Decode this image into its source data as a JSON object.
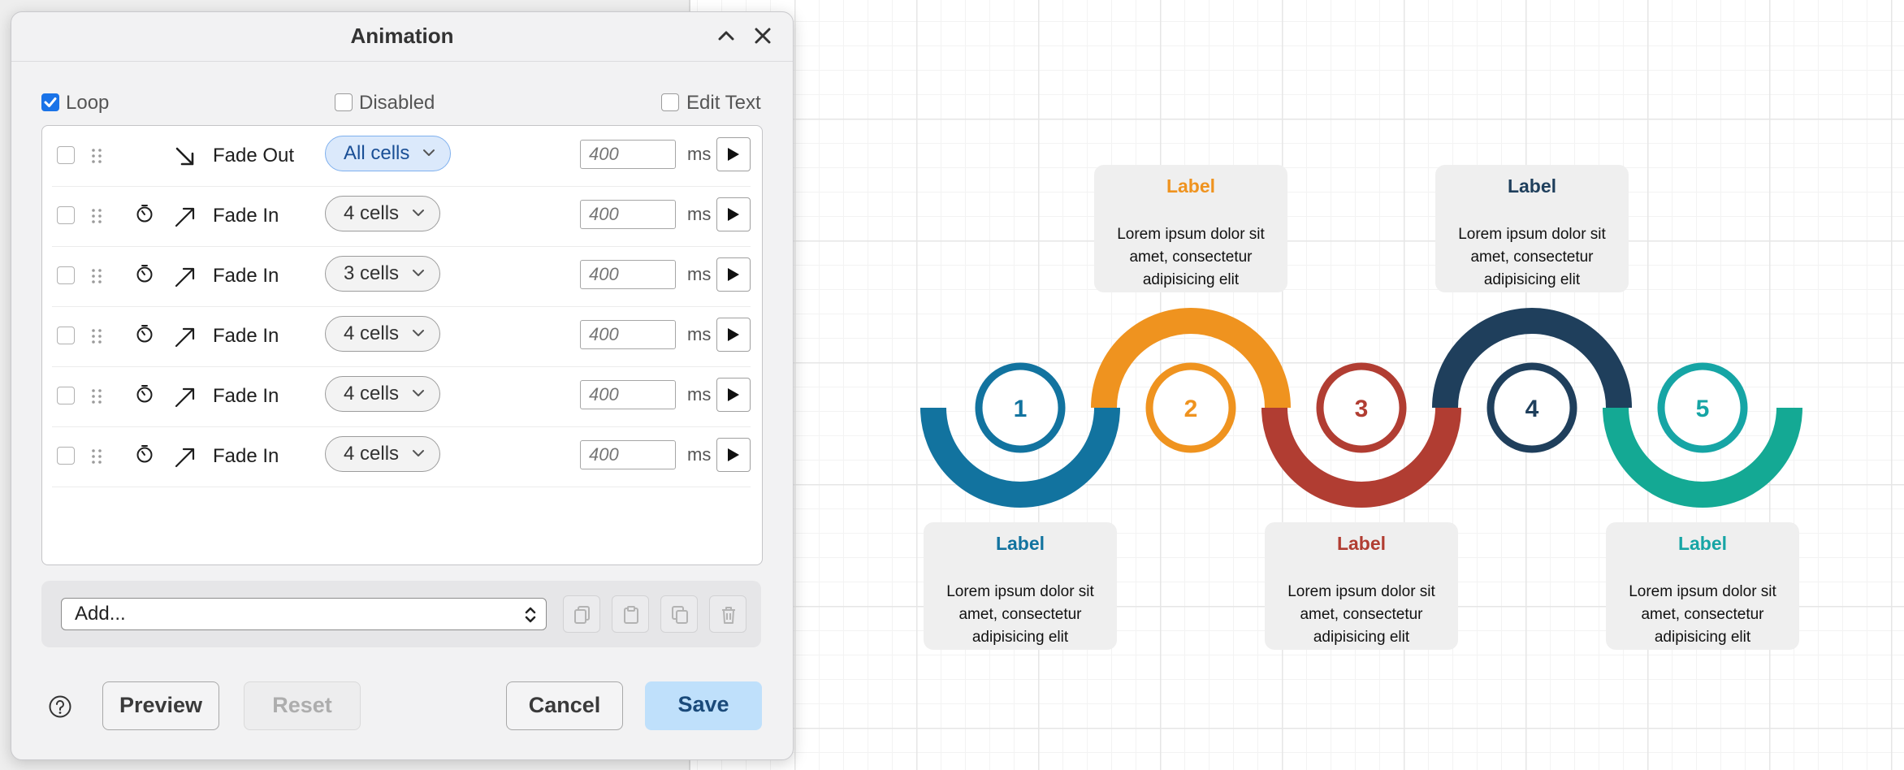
{
  "dialog": {
    "title": "Animation",
    "options": {
      "loop": "Loop",
      "disabled": "Disabled",
      "edit_text": "Edit Text"
    },
    "rows": [
      {
        "effect": "Fade Out",
        "target": "All cells",
        "duration_placeholder": "400",
        "unit": "ms"
      },
      {
        "effect": "Fade In",
        "target": "4 cells",
        "duration_placeholder": "400",
        "unit": "ms"
      },
      {
        "effect": "Fade In",
        "target": "3 cells",
        "duration_placeholder": "400",
        "unit": "ms"
      },
      {
        "effect": "Fade In",
        "target": "4 cells",
        "duration_placeholder": "400",
        "unit": "ms"
      },
      {
        "effect": "Fade In",
        "target": "4 cells",
        "duration_placeholder": "400",
        "unit": "ms"
      },
      {
        "effect": "Fade In",
        "target": "4 cells",
        "duration_placeholder": "400",
        "unit": "ms"
      }
    ],
    "add_select": "Add...",
    "buttons": {
      "preview": "Preview",
      "reset": "Reset",
      "cancel": "Cancel",
      "save": "Save"
    }
  },
  "diagram": {
    "steps": [
      {
        "num": "1",
        "label": "Label",
        "color": "#12739f",
        "text": [
          "Lorem ipsum dolor sit",
          "amet, consectetur",
          "adipisicing elit"
        ]
      },
      {
        "num": "2",
        "label": "Label",
        "color": "#ef931f",
        "text": [
          "Lorem ipsum dolor sit",
          "amet, consectetur",
          "adipisicing elit"
        ]
      },
      {
        "num": "3",
        "label": "Label",
        "color": "#b13d32",
        "text": [
          "Lorem ipsum dolor sit",
          "amet, consectetur",
          "adipisicing elit"
        ]
      },
      {
        "num": "4",
        "label": "Label",
        "color": "#1f3f5c",
        "text": [
          "Lorem ipsum dolor sit",
          "amet, consectetur",
          "adipisicing elit"
        ]
      },
      {
        "num": "5",
        "label": "Label",
        "color": "#16a5a5",
        "text": [
          "Lorem ipsum dolor sit",
          "amet, consectetur",
          "adipisicing elit"
        ]
      }
    ],
    "arc_colors": [
      "#12739f",
      "#ef931f",
      "#b13d32",
      "#1f3f5c",
      "#14a994"
    ]
  },
  "icons": {
    "collapse": "chevron-up-icon",
    "close": "close-icon",
    "grip": "drag-handle-icon",
    "timer": "timer-icon",
    "fade_out": "arrow-down-right-icon",
    "fade_in": "arrow-up-right-icon",
    "play": "play-icon",
    "copy": "copy-icon",
    "paste": "paste-icon",
    "duplicate": "duplicate-icon",
    "delete": "trash-icon",
    "help": "help-icon"
  }
}
